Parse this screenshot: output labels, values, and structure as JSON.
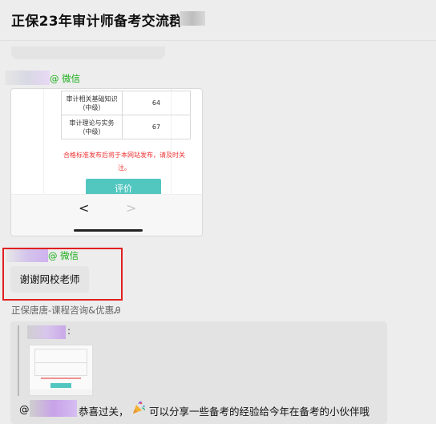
{
  "header": {
    "title": "正保23年审计师备考交流群"
  },
  "messages": [
    {
      "sender_tag": "@ 微信",
      "card": {
        "table_rows": [
          {
            "subject": "审计相关基础知识（中级）",
            "score": "64"
          },
          {
            "subject": "审计理论与实务（中级）",
            "score": "67"
          }
        ],
        "notice": "合格标准发布后将于本网站发布，请及时关注。",
        "button_label": "评价",
        "nav_back": "<",
        "nav_forward": ">"
      }
    },
    {
      "sender_tag": "@ 微信",
      "text": "谢谢网校老师"
    }
  ],
  "staff": {
    "name": "正保唐唐-课程咨询&优惠Ꭿ"
  },
  "reply": {
    "quote_colon": ":",
    "at_symbol": "@",
    "text_before_icon": "恭喜过关，",
    "text_after_icon": "可以分享一些备考的经验给今年在备考的小伙伴哦",
    "icon": "party-popper-icon"
  },
  "colors": {
    "wechat_tag": "#1aad19",
    "highlight_border": "#e02020",
    "button": "#52c7c0",
    "notice": "#ee3333"
  }
}
